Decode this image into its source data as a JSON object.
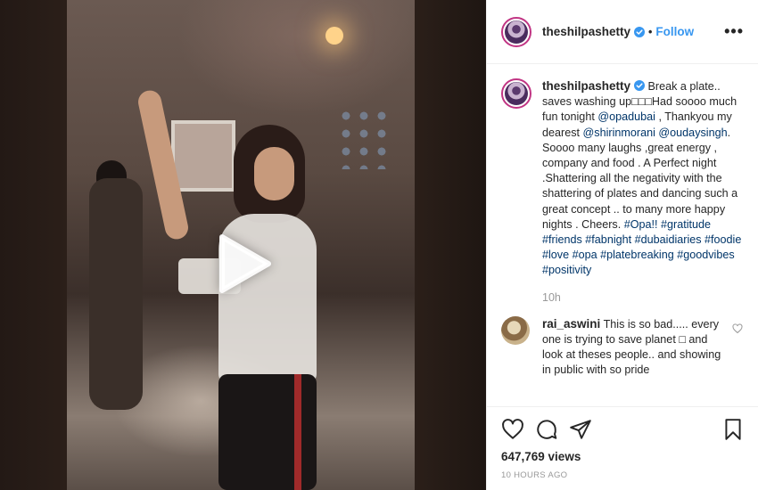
{
  "header": {
    "username": "theshilpashetty",
    "separator": "•",
    "follow_label": "Follow",
    "more_label": "•••",
    "verified_icon": "verified-badge-icon"
  },
  "caption": {
    "username": "theshilpashetty",
    "text_1": " Break a plate.. saves washing up□□□Had soooo much fun tonight ",
    "mention_1": "@opadubai",
    "text_2": " , Thankyou my dearest ",
    "mention_2": "@shirinmorani",
    "text_3": " ",
    "mention_3": "@oudaysingh",
    "text_4": ". Soooo many laughs ,great energy , company and food . A Perfect night .Shattering all the negativity with the shattering of plates and dancing such a great concept .. to many more happy nights . Cheers. ",
    "hashtags": "#Opa!! #gratitude #friends #fabnight #dubaidiaries #foodie #love #opa #platebreaking #goodvibes #positivity",
    "time": "10h"
  },
  "comment": {
    "username": "rai_aswini",
    "text": " This is so bad..... every one is trying to save planet □ and look at theses people.. and showing in public with so pride"
  },
  "actions": {
    "views": "647,769 views",
    "time_ago": "10 HOURS AGO"
  },
  "colors": {
    "accent": "#3897f0",
    "link": "#003569",
    "muted": "#999999",
    "text": "#262626"
  }
}
